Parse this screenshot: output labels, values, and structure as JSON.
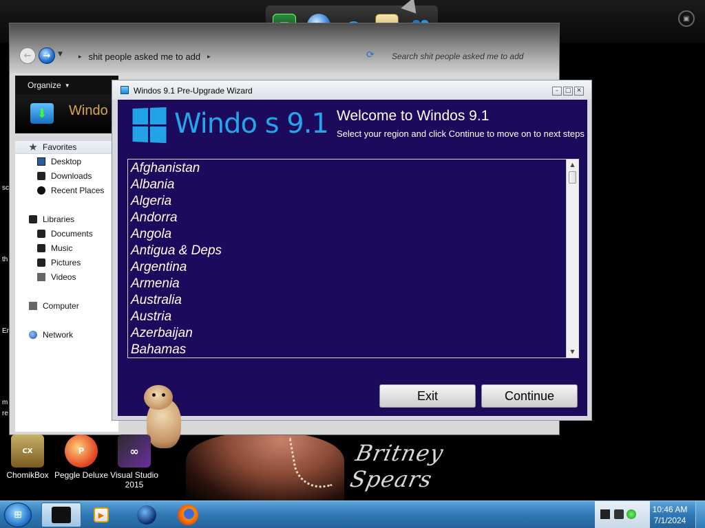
{
  "explorer": {
    "breadcrumb": "shit people asked me to add",
    "search_placeholder": "Search shit people asked me to add",
    "toolbar_organize": "Organize",
    "banner_title": "Windo",
    "nav": {
      "favorites": "Favorites",
      "desktop": "Desktop",
      "downloads": "Downloads",
      "recent_places": "Recent Places",
      "libraries": "Libraries",
      "documents": "Documents",
      "music": "Music",
      "pictures": "Pictures",
      "videos": "Videos",
      "computer": "Computer",
      "network": "Network"
    }
  },
  "edge_texts": [
    "sc",
    "th",
    "Er",
    "m",
    "re"
  ],
  "wizard": {
    "window_title": "Windos 9.1 Pre-Upgrade Wizard",
    "logo_text": "Windo   s 9.1",
    "welcome_title": "Welcome to Windos 9.1",
    "welcome_subtitle": "Select your region and click Continue to move on to next steps",
    "countries": [
      "Afghanistan",
      "Albania",
      "Algeria",
      "Andorra",
      "Angola",
      "Antigua & Deps",
      "Argentina",
      "Armenia",
      "Australia",
      "Austria",
      "Azerbaijan",
      "Bahamas"
    ],
    "exit_label": "Exit",
    "continue_label": "Continue"
  },
  "desktop_icons": {
    "chomikbox": "ChomikBox",
    "peggle": "Peggle Deluxe",
    "vs_line1": "Visual Studio",
    "vs_line2": "2015"
  },
  "wallpaper": {
    "signature": "Britney Spears"
  },
  "taskbar": {
    "time": "10:46 AM",
    "date": "7/1/2024"
  },
  "colors": {
    "wizard_bg": "#1c0a5c",
    "logo_blue": "#23a6ea",
    "taskbar_blue": "#2f78b6"
  }
}
